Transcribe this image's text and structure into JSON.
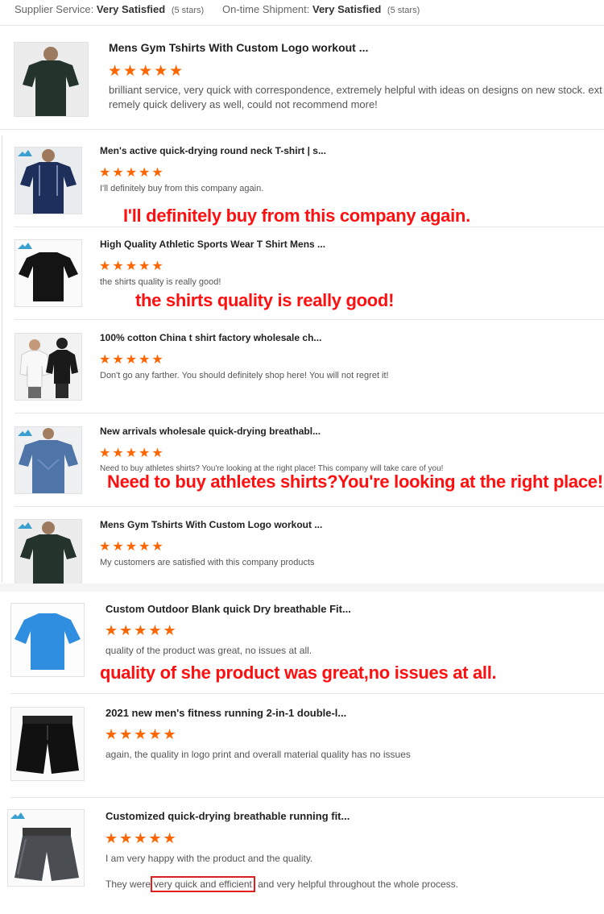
{
  "header": {
    "supplier_label": "Supplier Service:",
    "supplier_value": "Very Satisfied",
    "supplier_stars": "(5 stars)",
    "shipment_label": "On-time Shipment:",
    "shipment_value": "Very Satisfied",
    "shipment_stars": "(5 stars)"
  },
  "stars": "★★★★★",
  "reviews": [
    {
      "title": "Mens Gym Tshirts With Custom Logo workout ...",
      "text": "brilliant service, very quick with correspondence, extremely helpful with ideas on designs on new stock. ext",
      "text2": "remely quick delivery as well, could not recommend more!",
      "image": "dark-green-tshirt"
    },
    {
      "title": "Men's active quick-drying round neck T-shirt | s...",
      "text": "I'll definitely buy from this company again.",
      "annotation": "I'll definitely buy from this company again.",
      "image": "navy-tshirt"
    },
    {
      "title": "High Quality Athletic Sports Wear T Shirt Mens ...",
      "text": "the shirts quality is really good!",
      "annotation": "the shirts quality is really good!",
      "image": "black-tshirt"
    },
    {
      "title": "100% cotton China t shirt factory wholesale ch...",
      "text": "Don't go any farther. You should definitely shop here! You will not regret it!",
      "image": "couple-tshirts"
    },
    {
      "title": "New arrivals wholesale quick-drying breathabl...",
      "text": "Need to buy athletes shirts? You're looking at the right place! This company will take care of you!",
      "annotation": "Need to buy athletes shirts?You're looking at the right place!",
      "image": "blue-tshirt"
    },
    {
      "title": "Mens Gym Tshirts With Custom Logo workout ...",
      "text": "My customers are satisfied with this company products",
      "image": "dark-green-tshirt"
    },
    {
      "title": "Custom Outdoor Blank quick Dry breathable Fit...",
      "text": "quality of the product was great, no issues at all.",
      "annotation": "quality of she product was great,no issues at all.",
      "image": "sky-blue-tshirt"
    },
    {
      "title": "2021 new men's fitness running 2-in-1 double-l...",
      "text": "again, the quality in logo print and overall material quality has no issues",
      "image": "black-shorts"
    },
    {
      "title": "Customized quick-drying breathable running fit...",
      "text": "I am very happy with the product and the quality.",
      "text2_a": "They were",
      "text2_hl": "very quick and efficient",
      "text2_b": "and very helpful throughout the whole process.",
      "image": "grey-shorts"
    }
  ],
  "colors": {
    "star": "#ff6600",
    "annotation": "#ff1010",
    "highlight_box": "#e02020"
  }
}
